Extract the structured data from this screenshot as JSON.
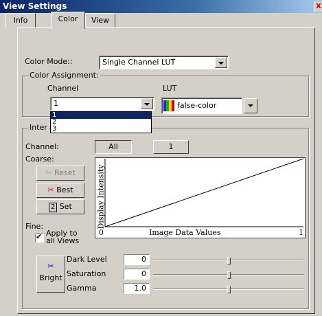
{
  "window": {
    "title": "View Settings",
    "close_glyph": "X"
  },
  "tabs": [
    {
      "label": "Info"
    },
    {
      "label": "Color"
    },
    {
      "label": "View"
    }
  ],
  "color_mode": {
    "label": "Color Mode::",
    "value": "Single Channel LUT"
  },
  "color_assignment": {
    "legend": "Color Assignment:",
    "channel_label": "Channel",
    "channel_value": "1",
    "channel_options": [
      "1",
      "2",
      "3"
    ],
    "lut_label": "LUT",
    "lut_value": "false-color"
  },
  "intensity": {
    "legend": "Inter",
    "channel_label": "Channel:",
    "all_label": "All",
    "one_label": "1",
    "coarse_label": "Coarse:",
    "reset_label": "Reset",
    "best_label": "Best",
    "set_num": "2",
    "set_label": "Set",
    "fine_label": "Fine:",
    "apply_label_1": "Apply to",
    "apply_label_2": "all Views",
    "apply_checked": true,
    "bright_label": "Bright"
  },
  "chart_data": {
    "type": "line",
    "xlabel": "Image Data Values",
    "ylabel": "Display Intensity",
    "x_tick_min": "0",
    "x_tick_max": "1",
    "x": [
      0,
      1
    ],
    "y": [
      0,
      1
    ],
    "xlim": [
      0,
      1
    ],
    "ylim": [
      0,
      1
    ]
  },
  "adjustments": [
    {
      "label": "Dark Level",
      "value": "0",
      "level": 0.5
    },
    {
      "label": "Saturation",
      "value": "0",
      "level": 0.5
    },
    {
      "label": "Gamma",
      "value": "1.0",
      "level": 0.5
    }
  ],
  "colors": {
    "title_start": "#0a246a",
    "title_end": "#a6caf0",
    "selection": "#0a246a",
    "best_icon": "#cc0000",
    "bright_icon": "#0000cc"
  }
}
